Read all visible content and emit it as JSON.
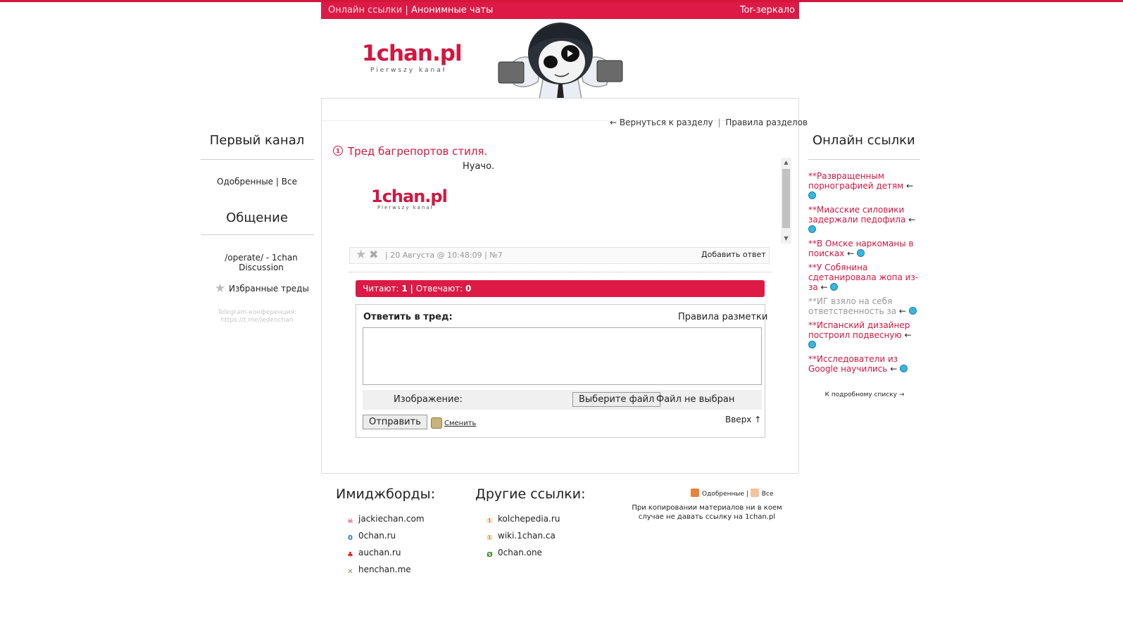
{
  "topbar": {
    "link1": "Онлайн ссылки",
    "sep": "|",
    "link2": "Анонимные чаты",
    "right": "Tor-зеркало"
  },
  "logo": {
    "title": "1chan.pl",
    "subtitle": "Pierwszy kanał"
  },
  "nav": {
    "back": "← Вернуться к разделу",
    "sep": "|",
    "rules": "Правила разделов"
  },
  "thread": {
    "title": "Тред багрепортов стиля.",
    "text": "Нуачо.",
    "image_logo": "1chan.pl",
    "image_sub": "Pierwszy kanał",
    "meta": "| 20 Августа @ 10:48:09 | №7",
    "add_reply": "Добавить ответ"
  },
  "stats": {
    "reading_label": "Читают:",
    "reading": "1",
    "sep": "|",
    "replying_label": "Отвечают:",
    "replying": "0"
  },
  "reply_form": {
    "label": "Ответить в тред:",
    "markup_rules": "Правила разметки",
    "image_label": "Изображение:",
    "file_button": "Выберите файл",
    "file_status": "Файл не выбран",
    "submit": "Отправить",
    "change": "Сменить",
    "up": "Вверх ↑"
  },
  "left_sidebar": {
    "heading1": "Первый канал",
    "approved": "Одобренные",
    "sep": "|",
    "all": "Все",
    "heading2": "Общение",
    "operate": "/operate/ - 1chan Discussion",
    "favorites": "Избранные треды",
    "telegram": "Telegram-конференция: https://t.me/jedenchan"
  },
  "right_sidebar": {
    "heading": "Онлайн ссылки",
    "items": [
      {
        "text": "**Развращенным порнографией детям",
        "style": "red"
      },
      {
        "text": "**Миасские силовики задержали педофила",
        "style": "red"
      },
      {
        "text": "**В Омске наркоманы в поисках",
        "style": "red"
      },
      {
        "text": "**У Собянина сдетанировала жопа из-за",
        "style": "red"
      },
      {
        "text": "**ИГ взяло на себя ответственность за",
        "style": "gray"
      },
      {
        "text": "**Испанский дизайнер построил подвесную",
        "style": "red"
      },
      {
        "text": "**Исследователи из Google научились",
        "style": "red"
      }
    ],
    "arrow": "←",
    "more": "К подробному списку →"
  },
  "footer": {
    "imageboards_heading": "Имиджборды:",
    "imageboards": [
      {
        "name": "jackiechan.com",
        "icon": "jackiechan-icon",
        "glyph": "☠",
        "color": "#c0152f"
      },
      {
        "name": "0chan.ru",
        "icon": "0chan-icon",
        "glyph": "0",
        "color": "#2a7ad1"
      },
      {
        "name": "auchan.ru",
        "icon": "auchan-bird-icon",
        "glyph": "♣",
        "color": "#e0201e"
      },
      {
        "name": "henchan.me",
        "icon": "henchan-icon",
        "glyph": "✕",
        "color": "#5aa84a"
      }
    ],
    "other_heading": "Другие ссылки:",
    "other": [
      {
        "name": "kolchepedia.ru",
        "icon": "kolchepedia-icon",
        "glyph": "①",
        "color": "#e07a18"
      },
      {
        "name": "wiki.1chan.ca",
        "icon": "wiki-icon",
        "glyph": "①",
        "color": "#e07a18"
      },
      {
        "name": "0chan.one",
        "icon": "0chan-one-icon",
        "glyph": "Ø",
        "color": "#3b8a1e"
      }
    ],
    "feeds_approved": "Одобренные",
    "feeds_sep": "|",
    "feeds_all": "Все",
    "copyright": "При копировании материалов ни в коем случае не давать ссылку на 1chan.pl"
  }
}
